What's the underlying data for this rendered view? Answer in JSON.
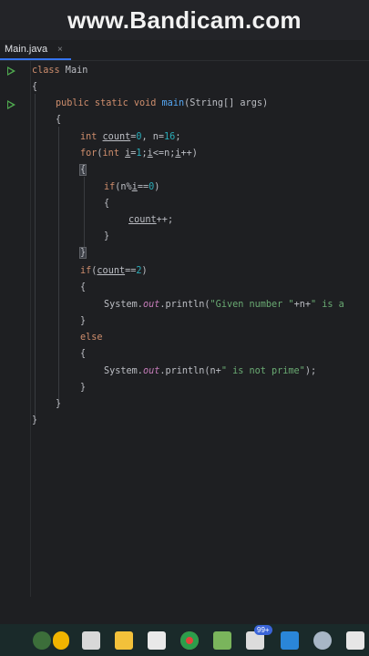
{
  "watermark": {
    "text": "www.Bandicam.com"
  },
  "tab": {
    "label": "Main.java",
    "close": "×"
  },
  "code": {
    "l1": {
      "kw": "class",
      "rest": " Main"
    },
    "l2": "{",
    "l3": {
      "kw": "public static void",
      "fn": "main",
      "rest": "(String[] args)"
    },
    "l4": "{",
    "l5": {
      "kw": "int",
      "var": "count",
      "eq": "=",
      "n0": "0",
      "mid": ", n=",
      "n16": "16",
      "end": ";"
    },
    "l6": {
      "kw1": "for",
      "p1": "(",
      "kw2": "int",
      "sp": " ",
      "i1": "i",
      "eq": "=",
      "n1": "1",
      "semi1": ";",
      "i2": "i",
      "le": "<=n;",
      "i3": "i",
      "pp": "++)"
    },
    "l7": "{",
    "l8": {
      "kw": "if",
      "p1": "(n%",
      "i": "i",
      "rest": "==",
      "n0": "0",
      "close": ")"
    },
    "l9": "{",
    "l10": {
      "var": "count",
      "rest": "++;"
    },
    "l11": "}",
    "l12": "}",
    "l13": {
      "kw": "if",
      "p1": "(",
      "var": "count",
      "rest": "==",
      "n2": "2",
      "close": ")"
    },
    "l14": "{",
    "l15": {
      "cls": "System.",
      "field": "out",
      "call": ".println(",
      "str": "\"Given number \"",
      "plus": "+n+",
      "str2": "\" is a"
    },
    "l16": "}",
    "l17": {
      "kw": "else"
    },
    "l18": "{",
    "l19": {
      "cls": "System.",
      "field": "out",
      "call": ".println(n+",
      "str": "\" is not prime\"",
      "end": ");"
    },
    "l20": "}",
    "l21": "}",
    "l22": "}"
  },
  "taskbar": {
    "icons": [
      "widgets-icon",
      "task-view-icon",
      "file-explorer-icon",
      "store-icon",
      "chrome-icon",
      "notepad-icon",
      "notification-app-icon",
      "vscode-icon",
      "settings-icon",
      "app-icon"
    ],
    "badge": "99+"
  },
  "colors": {
    "keyword": "#cf8e6d",
    "function": "#56a8f5",
    "number": "#2aacb8",
    "string": "#6aab73",
    "field": "#c77dbb",
    "accent": "#3574f0"
  }
}
